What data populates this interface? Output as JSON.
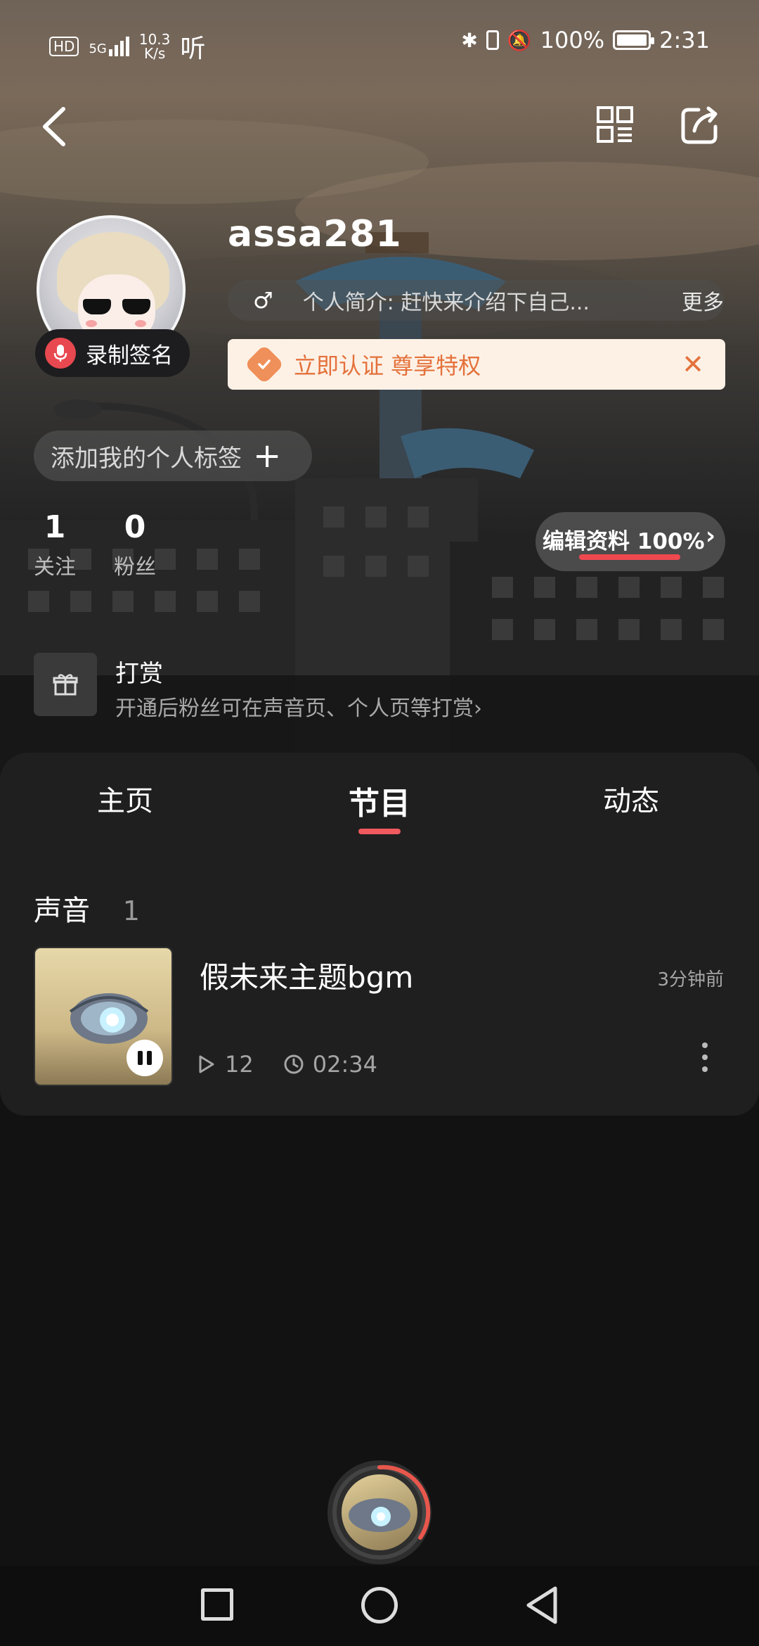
{
  "status_bar": {
    "hd_badge": "HD",
    "network": "5G",
    "speed_value": "10.3",
    "speed_unit": "K/s",
    "app_glyph": "听",
    "battery_percent": "100%",
    "time": "2:31"
  },
  "profile": {
    "username": "assa281",
    "gender_symbol": "♂",
    "bio": "个人简介: 赶快来介绍下自己...",
    "bio_more": "更多",
    "record_label": "录制签名",
    "verify_text": "立即认证 尊享特权",
    "add_tag_label": "添加我的个人标签",
    "following_count": "1",
    "following_label": "关注",
    "fans_count": "0",
    "fans_label": "粉丝",
    "edit_label": "编辑资料 100%",
    "edit_progress": 1.0,
    "tip_title": "打赏",
    "tip_desc": "开通后粉丝可在声音页、个人页等打赏›"
  },
  "tabs": [
    {
      "label": "主页",
      "active": false
    },
    {
      "label": "节目",
      "active": true
    },
    {
      "label": "动态",
      "active": false
    }
  ],
  "section": {
    "title": "声音",
    "count": "1"
  },
  "track": {
    "title": "假未来主题bgm",
    "posted": "3分钟前",
    "plays": "12",
    "duration": "02:34"
  },
  "colors": {
    "accent": "#f0595d",
    "verify_bg": "#fdf1e6",
    "verify_text": "#e4713b"
  }
}
